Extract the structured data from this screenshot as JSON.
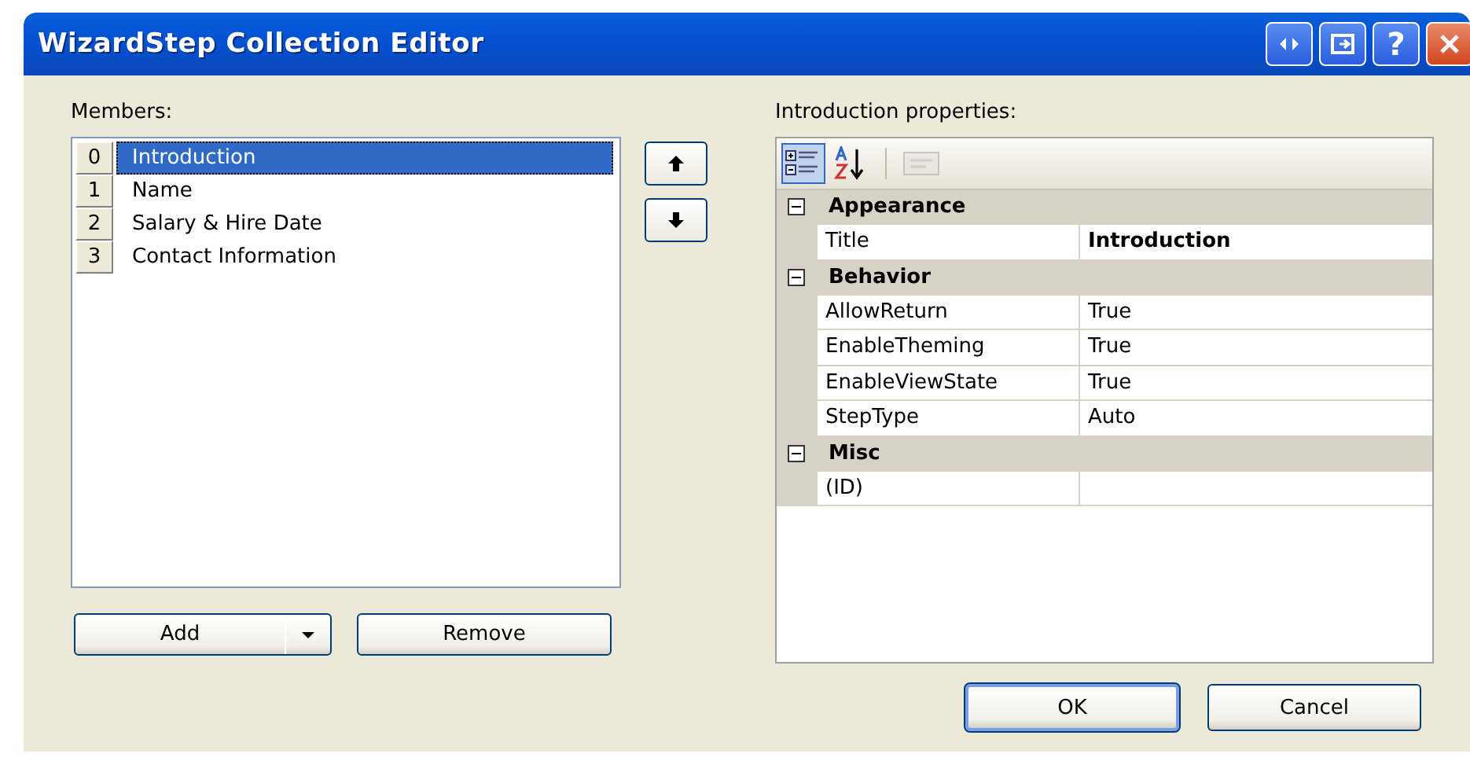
{
  "window": {
    "title": "WizardStep Collection Editor"
  },
  "title_buttons": [
    {
      "kind": "arrows"
    },
    {
      "kind": "restore"
    },
    {
      "kind": "help",
      "label": "?"
    },
    {
      "kind": "close"
    }
  ],
  "members": {
    "label": "Members:",
    "items": [
      {
        "index": "0",
        "name": "Introduction",
        "selected": true
      },
      {
        "index": "1",
        "name": "Name",
        "selected": false
      },
      {
        "index": "2",
        "name": "Salary & Hire Date",
        "selected": false
      },
      {
        "index": "3",
        "name": "Contact Information",
        "selected": false
      }
    ],
    "move_buttons": [
      {
        "kind": "up"
      },
      {
        "kind": "down"
      }
    ],
    "add_button": {
      "label": "Add"
    },
    "remove_button": {
      "label": "Remove"
    }
  },
  "properties": {
    "label": "Introduction properties:",
    "toolbar": [
      {
        "kind": "categorized",
        "selected": true,
        "disabled": false
      },
      {
        "kind": "alphabetical",
        "selected": false,
        "disabled": false
      },
      {
        "kind": "pages",
        "selected": false,
        "disabled": true
      }
    ],
    "categories": [
      {
        "name": "Appearance",
        "expanded": true,
        "rows": [
          {
            "name": "Title",
            "value": "Introduction",
            "bold": true
          }
        ]
      },
      {
        "name": "Behavior",
        "expanded": true,
        "rows": [
          {
            "name": "AllowReturn",
            "value": "True",
            "bold": false
          },
          {
            "name": "EnableTheming",
            "value": "True",
            "bold": false
          },
          {
            "name": "EnableViewState",
            "value": "True",
            "bold": false
          },
          {
            "name": "StepType",
            "value": "Auto",
            "bold": false
          }
        ]
      },
      {
        "name": "Misc",
        "expanded": true,
        "rows": [
          {
            "name": "(ID)"
          }
        ]
      }
    ]
  },
  "buttons": [
    {
      "label": "OK",
      "default": true
    },
    {
      "label": "Cancel",
      "default": false
    }
  ]
}
